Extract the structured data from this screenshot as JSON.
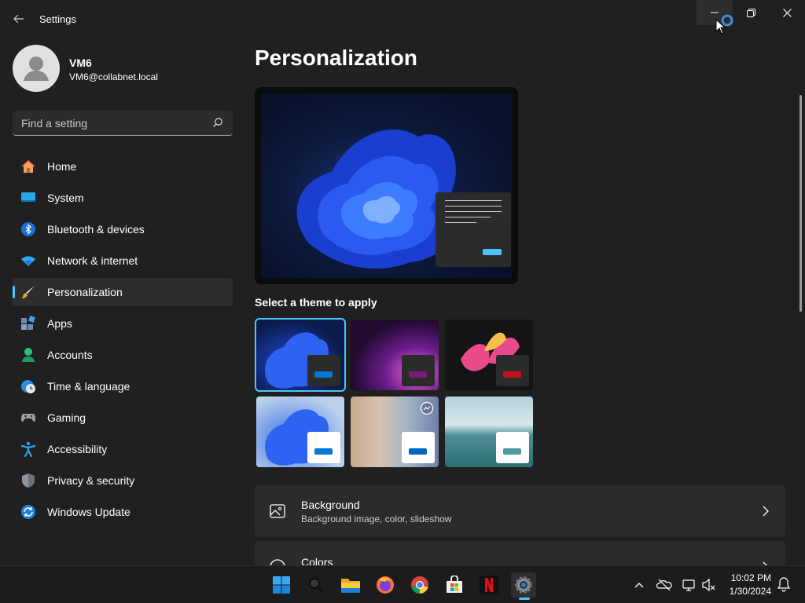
{
  "window": {
    "title": "Settings",
    "controls": {
      "minimize": "minimize-icon",
      "maximize": "restore-icon",
      "close": "close-icon"
    }
  },
  "profile": {
    "name": "VM6",
    "email": "VM6@collabnet.local"
  },
  "search": {
    "placeholder": "Find a setting",
    "value": ""
  },
  "nav": {
    "items": [
      {
        "label": "Home",
        "icon": "home-icon"
      },
      {
        "label": "System",
        "icon": "system-icon"
      },
      {
        "label": "Bluetooth & devices",
        "icon": "bluetooth-icon"
      },
      {
        "label": "Network & internet",
        "icon": "wifi-icon"
      },
      {
        "label": "Personalization",
        "icon": "brush-icon",
        "active": true
      },
      {
        "label": "Apps",
        "icon": "apps-icon"
      },
      {
        "label": "Accounts",
        "icon": "accounts-icon"
      },
      {
        "label": "Time & language",
        "icon": "globe-clock-icon"
      },
      {
        "label": "Gaming",
        "icon": "gamepad-icon"
      },
      {
        "label": "Accessibility",
        "icon": "accessibility-icon"
      },
      {
        "label": "Privacy & security",
        "icon": "shield-icon"
      },
      {
        "label": "Windows Update",
        "icon": "update-icon"
      }
    ]
  },
  "main": {
    "title": "Personalization",
    "themes_heading": "Select a theme to apply",
    "themes": [
      {
        "name": "windows-dark-bloom",
        "accent": "#0078d4",
        "selected": true
      },
      {
        "name": "glow",
        "accent": "#7a1b7a"
      },
      {
        "name": "captured-motion",
        "accent": "#c50f1f"
      },
      {
        "name": "windows-light-bloom",
        "accent": "#0078d4"
      },
      {
        "name": "windows-spotlight",
        "accent": "#0067c0"
      },
      {
        "name": "flow",
        "accent": "#4f9aa0"
      }
    ],
    "cards": [
      {
        "title": "Background",
        "subtitle": "Background image, color, slideshow",
        "icon": "background-image-icon"
      },
      {
        "title": "Colors",
        "subtitle": "",
        "icon": "palette-icon"
      }
    ]
  },
  "taskbar": {
    "apps": [
      "start-icon",
      "search-icon",
      "file-explorer-icon",
      "firefox-icon",
      "chrome-icon",
      "microsoft-store-icon",
      "netflix-icon",
      "settings-icon"
    ],
    "tray": [
      "chevron-up-icon",
      "onedrive-icon",
      "network-icon",
      "volume-muted-icon"
    ],
    "clock": {
      "time": "10:02 PM",
      "date": "1/30/2024"
    },
    "notifications_icon": "bell-icon"
  },
  "colors": {
    "accent": "#4cc2ff",
    "background": "#202020",
    "card": "#2b2b2b"
  }
}
